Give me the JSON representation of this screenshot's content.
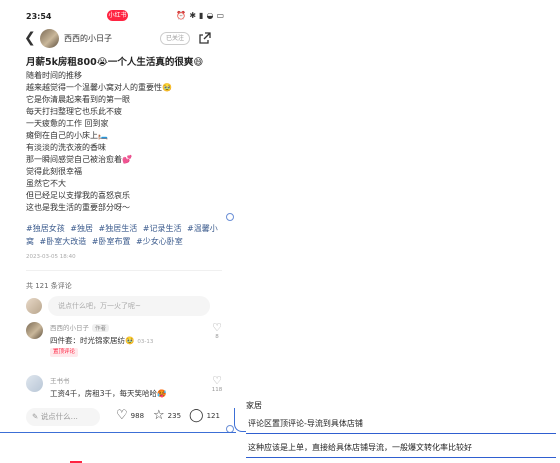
{
  "status_bar": {
    "time": "23:54",
    "pill": "小红书",
    "icons": [
      "alarm-icon",
      "bluetooth-icon",
      "signal-icon",
      "wifi-icon",
      "battery-icon"
    ]
  },
  "nav": {
    "author_name": "西西的小日子",
    "follow_label": "已关注"
  },
  "post": {
    "title": "月薪5k房租800😭一个人生活真的很爽😄",
    "lines": [
      "随着时间的推移",
      "越来越觉得一个温馨小窝对人的重要性🥹",
      "它是你清晨起来看到的第一眼",
      "每天打扫整理它也乐此不疲",
      "一天疲惫的工作 回到家",
      "瘫倒在自己的小床上🛏️",
      "有淡淡的洗衣液的香味",
      "那一瞬间感觉自己被治愈着💕",
      "觉得此刻很幸福",
      "虽然它不大",
      "但已经足以支撑我的喜怒哀乐",
      "这也是我生活的重要部分呀～"
    ],
    "tags": [
      "#独居女孩",
      "#独居",
      "#独居生活",
      "#记录生活",
      "#温馨小窝",
      "#卧室大改造",
      "#卧室布置",
      "#少女心卧室"
    ],
    "date": "2023-03-05 18:40"
  },
  "comments": {
    "count_label": "共 121 条评论",
    "input_placeholder": "说点什么吧，万一火了呢~",
    "items": [
      {
        "name": "西西的小日子",
        "badge": "作者",
        "text": "四件套：时光锦家居纺🥹",
        "date": "03-13",
        "pinned": "置顶评论",
        "likes": "8"
      },
      {
        "name": "王书书",
        "text": "工资4千，房租3千，每天笑哈哈🥵",
        "likes": "118"
      }
    ]
  },
  "bottom_bar": {
    "input_placeholder": "说点什么...",
    "likes": "988",
    "stars": "235",
    "comments": "121"
  },
  "notes": {
    "tag": "家居",
    "lines": [
      "评论区置顶评论-导流到具体店铺",
      "这种应该是上单，直接给具体店铺导流，一般爆文转化率比较好"
    ]
  },
  "colors": {
    "brand_red": "#ff2442",
    "tag_blue": "#3a5a8c",
    "annotation_blue": "#3c6fd6"
  }
}
